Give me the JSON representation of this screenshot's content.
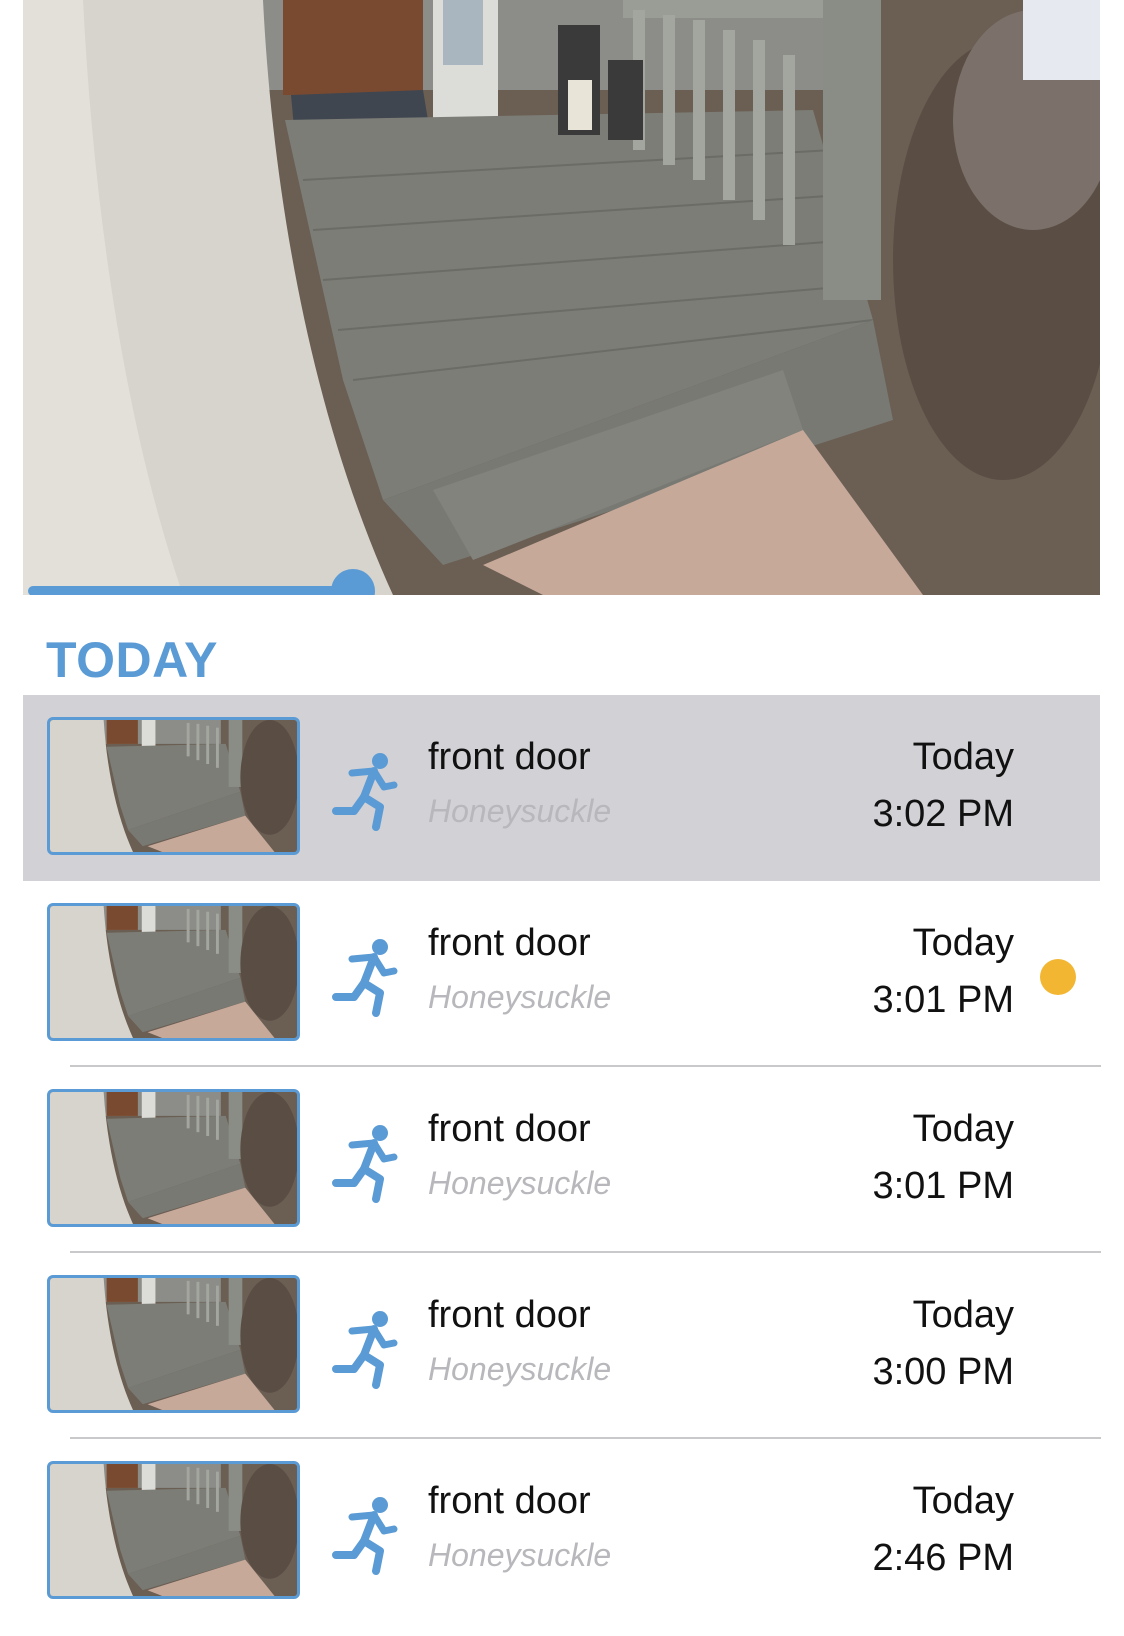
{
  "player": {
    "progress": 0.29
  },
  "section": {
    "title": "TODAY"
  },
  "colors": {
    "accent": "#5b9bd5",
    "selected_row_bg": "#d1d1d6",
    "unread_dot": "#f2b632"
  },
  "events": [
    {
      "title": "front door",
      "subtitle": "Honeysuckle",
      "day": "Today",
      "time": "3:02 PM",
      "icon": "running-person-icon",
      "selected": true,
      "unread": false
    },
    {
      "title": "front door",
      "subtitle": "Honeysuckle",
      "day": "Today",
      "time": "3:01 PM",
      "icon": "running-person-icon",
      "selected": false,
      "unread": true
    },
    {
      "title": "front door",
      "subtitle": "Honeysuckle",
      "day": "Today",
      "time": "3:01 PM",
      "icon": "running-person-icon",
      "selected": false,
      "unread": false
    },
    {
      "title": "front door",
      "subtitle": "Honeysuckle",
      "day": "Today",
      "time": "3:00 PM",
      "icon": "running-person-icon",
      "selected": false,
      "unread": false
    },
    {
      "title": "front door",
      "subtitle": "Honeysuckle",
      "day": "Today",
      "time": "2:46 PM",
      "icon": "running-person-icon",
      "selected": false,
      "unread": false
    }
  ]
}
